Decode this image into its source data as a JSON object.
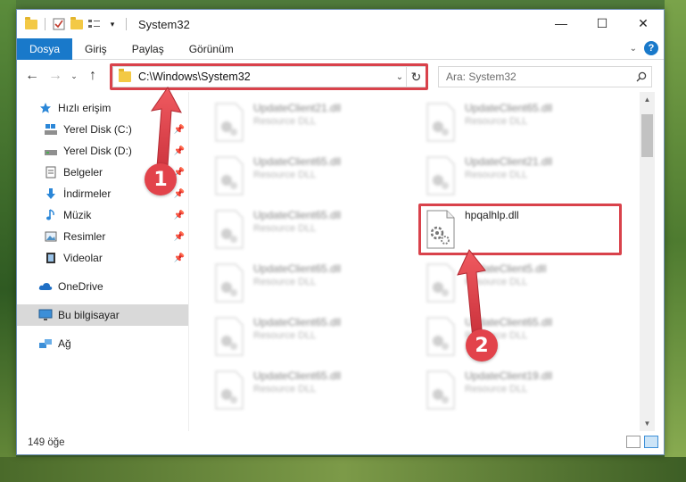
{
  "window": {
    "title": "System32",
    "controls": {
      "minimize": "—",
      "maximize": "☐",
      "close": "✕"
    }
  },
  "ribbon": {
    "tabs": [
      "Dosya",
      "Giriş",
      "Paylaş",
      "Görünüm"
    ],
    "help": "?"
  },
  "navigation": {
    "address": "C:\\Windows\\System32",
    "search_placeholder": "Ara: System32"
  },
  "sidebar": {
    "quick_access": "Hızlı erişim",
    "pinned": [
      {
        "label": "Yerel Disk (C:)",
        "icon": "drive-icon"
      },
      {
        "label": "Yerel Disk (D:)",
        "icon": "drive-icon"
      },
      {
        "label": "Belgeler",
        "icon": "documents-icon"
      },
      {
        "label": "İndirmeler",
        "icon": "download-icon"
      },
      {
        "label": "Müzik",
        "icon": "music-icon"
      },
      {
        "label": "Resimler",
        "icon": "pictures-icon"
      },
      {
        "label": "Videolar",
        "icon": "videos-icon"
      }
    ],
    "onedrive": "OneDrive",
    "this_pc": "Bu bilgisayar",
    "network": "Ağ"
  },
  "files": [
    {
      "name": "UpdateClient21.dll",
      "desc": "Resource DLL"
    },
    {
      "name": "UpdateClient65.dll",
      "desc": "Resource DLL"
    },
    {
      "name": "UpdateClient65.dll",
      "desc": "Resource DLL"
    },
    {
      "name": "UpdateClient21.dll",
      "desc": "Resource DLL"
    },
    {
      "name": "UpdateClient65.dll",
      "desc": "Resource DLL"
    },
    {
      "name": "hpqalhlp.dll",
      "desc": ""
    },
    {
      "name": "UpdateClient65.dll",
      "desc": "Resource DLL"
    },
    {
      "name": "UpdateClient5.dll",
      "desc": "Resource DLL"
    },
    {
      "name": "UpdateClient65.dll",
      "desc": "Resource DLL"
    },
    {
      "name": "UpdateClient65.dll",
      "desc": "Resource DLL"
    },
    {
      "name": "UpdateClient65.dll",
      "desc": "Resource DLL"
    },
    {
      "name": "UpdateClient19.dll",
      "desc": "Resource DLL"
    }
  ],
  "status": {
    "item_count": "149 öğe"
  },
  "annotations": {
    "badge1": "1",
    "badge2": "2",
    "color": "#e2434b"
  }
}
